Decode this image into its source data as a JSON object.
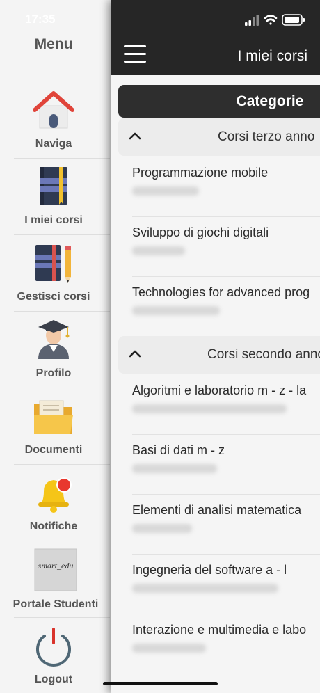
{
  "status_bar": {
    "time": "17:35"
  },
  "menu": {
    "title": "Menu",
    "items": [
      {
        "label": "Naviga",
        "icon": "home-icon"
      },
      {
        "label": "I miei corsi",
        "icon": "book-icon"
      },
      {
        "label": "Gestisci corsi",
        "icon": "books-pencil-icon"
      },
      {
        "label": "Profilo",
        "icon": "graduate-icon"
      },
      {
        "label": "Documenti",
        "icon": "folder-icon"
      },
      {
        "label": "Notifiche",
        "icon": "bell-icon"
      },
      {
        "label": "Portale Studenti",
        "icon": "smart-edu-icon",
        "logo_text": "smart_edu"
      },
      {
        "label": "Logout",
        "icon": "power-icon"
      }
    ]
  },
  "header": {
    "title": "I miei corsi"
  },
  "categories": {
    "label": "Categorie"
  },
  "sections": [
    {
      "title": "Corsi terzo anno",
      "courses": [
        {
          "title": "Programmazione mobile"
        },
        {
          "title": "Sviluppo di giochi digitali"
        },
        {
          "title": "Technologies for advanced prog"
        }
      ]
    },
    {
      "title": "Corsi secondo anno",
      "courses": [
        {
          "title": "Algoritmi e laboratorio m - z - la"
        },
        {
          "title": "Basi di dati m - z"
        },
        {
          "title": "Elementi di analisi matematica"
        },
        {
          "title": "Ingegneria del software a - l"
        },
        {
          "title": "Interazione e multimedia e labo"
        }
      ]
    }
  ],
  "colors": {
    "header_bg": "#262626",
    "menu_bg": "#f4f4f4",
    "badge_red": "#e8382e",
    "bell_yellow": "#f5c518"
  }
}
